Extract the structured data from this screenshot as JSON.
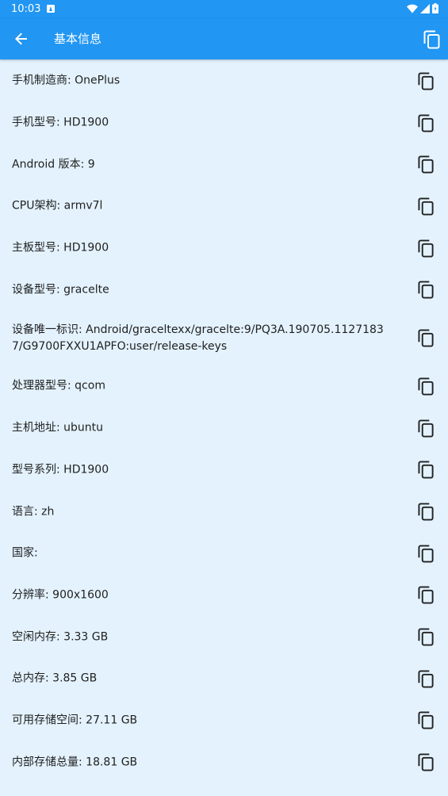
{
  "status_bar": {
    "time": "10:03",
    "icons": [
      "notification-a-icon",
      "wifi-icon",
      "signal-icon",
      "battery-icon"
    ]
  },
  "app_bar": {
    "title": "基本信息",
    "background_color": "#2196F3",
    "icons": [
      "back-arrow-icon",
      "copy-all-icon"
    ]
  },
  "list_background_color": "#E3F2FD",
  "items": [
    {
      "text": "手机制造商: OnePlus"
    },
    {
      "text": "手机型号: HD1900"
    },
    {
      "text": "Android 版本: 9"
    },
    {
      "text": "CPU架构: armv7l"
    },
    {
      "text": "主板型号: HD1900"
    },
    {
      "text": "设备型号: gracelte"
    },
    {
      "text": "设备唯一标识: Android/graceltexx/gracelte:9/PQ3A.190705.11271837/G9700FXXU1APFO:user/release-keys"
    },
    {
      "text": "处理器型号: qcom"
    },
    {
      "text": "主机地址: ubuntu"
    },
    {
      "text": "型号系列: HD1900"
    },
    {
      "text": "语言: zh"
    },
    {
      "text": "国家: "
    },
    {
      "text": "分辨率: 900x1600"
    },
    {
      "text": "空闲内存: 3.33 GB"
    },
    {
      "text": "总内存: 3.85 GB"
    },
    {
      "text": "可用存储空间: 27.11 GB"
    },
    {
      "text": "内部存储总量: 18.81 GB"
    }
  ],
  "item_icon": "copy-icon"
}
